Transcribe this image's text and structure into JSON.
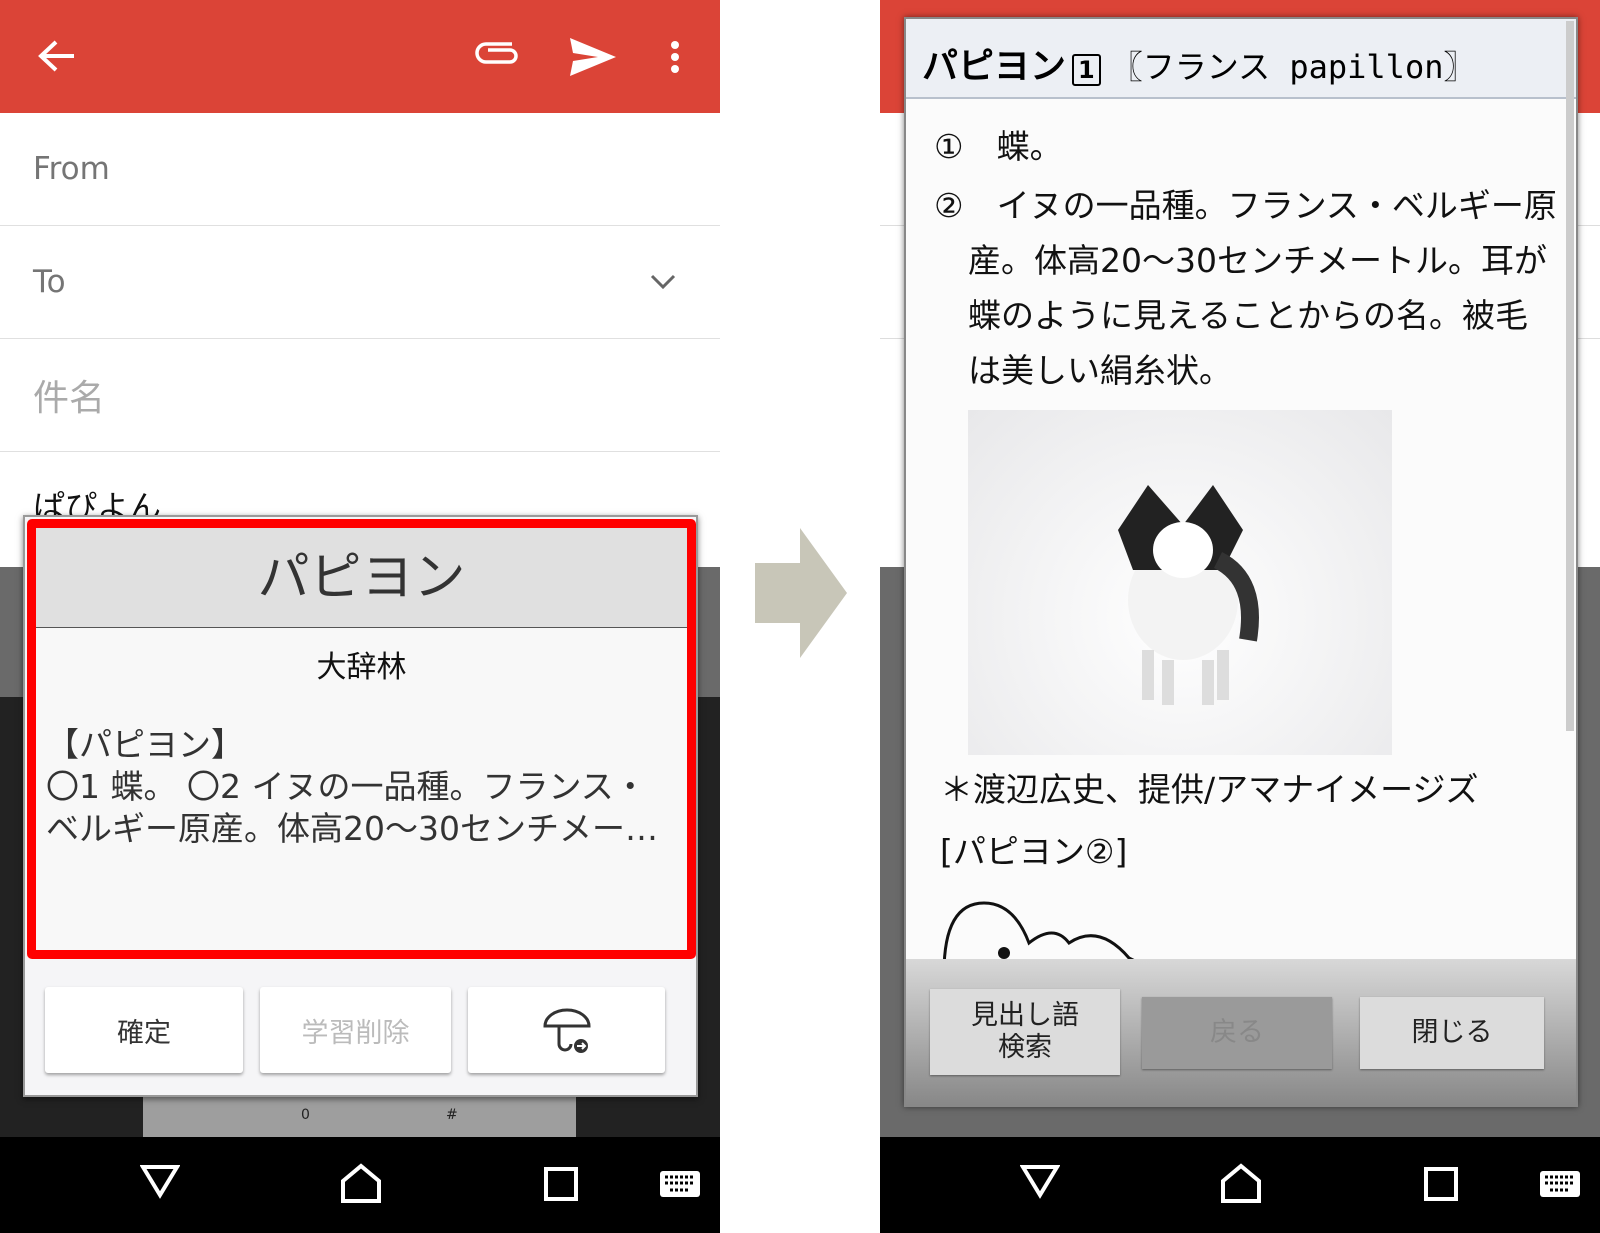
{
  "left": {
    "appbar": {
      "color": "#db4437",
      "icons": [
        "arrow-back-icon",
        "paperclip-icon",
        "send-icon",
        "more-vert-icon"
      ]
    },
    "from_label": "From",
    "to_label": "To",
    "subject_placeholder": "件名",
    "body_text": "ぱぴよん",
    "popup": {
      "title": "パピヨン",
      "source": "大辞林",
      "headword": "【パピヨン】",
      "snippet": "〇1 蝶。 〇2 イヌの一品種。フランス・ベルギー原産。体高20〜30センチメー…",
      "confirm": "確定",
      "delete_learning": "学習削除",
      "dictionary_icon": "mushroom-dictionary-icon"
    },
    "keyboard_keys": [
      "0",
      "#"
    ]
  },
  "right": {
    "dialog": {
      "headword": "パピヨン",
      "homograph": "1",
      "etymology": "〖フランス papillon〗",
      "sense1_mark": "①",
      "sense1": "蝶。",
      "sense2_mark": "②",
      "sense2": "イヌの一品種。フランス・ベルギー原産。体高20〜30センチメートル。耳が蝶のように見えることからの名。被毛は美しい絹糸状。",
      "photo_credit": "＊渡辺広史、提供/アマナイメージズ",
      "illustration_caption": "[パピヨン②]",
      "btn_search": "見出し語検索",
      "btn_back": "戻る",
      "btn_close": "閉じる"
    }
  },
  "nav_icons": [
    "back-triangle-icon",
    "home-icon",
    "recents-icon",
    "keyboard-icon"
  ]
}
